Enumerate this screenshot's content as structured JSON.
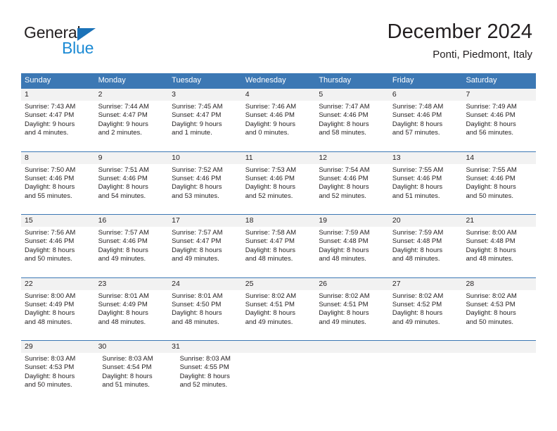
{
  "brand": {
    "name_primary": "General",
    "name_secondary": "Blue",
    "triangle_icon": "brand-triangle-icon",
    "primary_color": "#231f20",
    "secondary_color": "#1b8ad4",
    "triangle_color": "#1b72b8"
  },
  "header": {
    "title": "December 2024",
    "subtitle": "Ponti, Piedmont, Italy"
  },
  "theme": {
    "header_row_bg": "#3c78b4",
    "header_row_text": "#ffffff",
    "daynum_band_bg": "#f2f2f2",
    "grid_line": "#3c78b4",
    "body_text": "#231f20"
  },
  "weekdays": [
    "Sunday",
    "Monday",
    "Tuesday",
    "Wednesday",
    "Thursday",
    "Friday",
    "Saturday"
  ],
  "weeks": [
    {
      "days": [
        {
          "num": "1",
          "sunrise": "Sunrise: 7:43 AM",
          "sunset": "Sunset: 4:47 PM",
          "daylight1": "Daylight: 9 hours",
          "daylight2": "and 4 minutes."
        },
        {
          "num": "2",
          "sunrise": "Sunrise: 7:44 AM",
          "sunset": "Sunset: 4:47 PM",
          "daylight1": "Daylight: 9 hours",
          "daylight2": "and 2 minutes."
        },
        {
          "num": "3",
          "sunrise": "Sunrise: 7:45 AM",
          "sunset": "Sunset: 4:47 PM",
          "daylight1": "Daylight: 9 hours",
          "daylight2": "and 1 minute."
        },
        {
          "num": "4",
          "sunrise": "Sunrise: 7:46 AM",
          "sunset": "Sunset: 4:46 PM",
          "daylight1": "Daylight: 9 hours",
          "daylight2": "and 0 minutes."
        },
        {
          "num": "5",
          "sunrise": "Sunrise: 7:47 AM",
          "sunset": "Sunset: 4:46 PM",
          "daylight1": "Daylight: 8 hours",
          "daylight2": "and 58 minutes."
        },
        {
          "num": "6",
          "sunrise": "Sunrise: 7:48 AM",
          "sunset": "Sunset: 4:46 PM",
          "daylight1": "Daylight: 8 hours",
          "daylight2": "and 57 minutes."
        },
        {
          "num": "7",
          "sunrise": "Sunrise: 7:49 AM",
          "sunset": "Sunset: 4:46 PM",
          "daylight1": "Daylight: 8 hours",
          "daylight2": "and 56 minutes."
        }
      ]
    },
    {
      "days": [
        {
          "num": "8",
          "sunrise": "Sunrise: 7:50 AM",
          "sunset": "Sunset: 4:46 PM",
          "daylight1": "Daylight: 8 hours",
          "daylight2": "and 55 minutes."
        },
        {
          "num": "9",
          "sunrise": "Sunrise: 7:51 AM",
          "sunset": "Sunset: 4:46 PM",
          "daylight1": "Daylight: 8 hours",
          "daylight2": "and 54 minutes."
        },
        {
          "num": "10",
          "sunrise": "Sunrise: 7:52 AM",
          "sunset": "Sunset: 4:46 PM",
          "daylight1": "Daylight: 8 hours",
          "daylight2": "and 53 minutes."
        },
        {
          "num": "11",
          "sunrise": "Sunrise: 7:53 AM",
          "sunset": "Sunset: 4:46 PM",
          "daylight1": "Daylight: 8 hours",
          "daylight2": "and 52 minutes."
        },
        {
          "num": "12",
          "sunrise": "Sunrise: 7:54 AM",
          "sunset": "Sunset: 4:46 PM",
          "daylight1": "Daylight: 8 hours",
          "daylight2": "and 52 minutes."
        },
        {
          "num": "13",
          "sunrise": "Sunrise: 7:55 AM",
          "sunset": "Sunset: 4:46 PM",
          "daylight1": "Daylight: 8 hours",
          "daylight2": "and 51 minutes."
        },
        {
          "num": "14",
          "sunrise": "Sunrise: 7:55 AM",
          "sunset": "Sunset: 4:46 PM",
          "daylight1": "Daylight: 8 hours",
          "daylight2": "and 50 minutes."
        }
      ]
    },
    {
      "days": [
        {
          "num": "15",
          "sunrise": "Sunrise: 7:56 AM",
          "sunset": "Sunset: 4:46 PM",
          "daylight1": "Daylight: 8 hours",
          "daylight2": "and 50 minutes."
        },
        {
          "num": "16",
          "sunrise": "Sunrise: 7:57 AM",
          "sunset": "Sunset: 4:46 PM",
          "daylight1": "Daylight: 8 hours",
          "daylight2": "and 49 minutes."
        },
        {
          "num": "17",
          "sunrise": "Sunrise: 7:57 AM",
          "sunset": "Sunset: 4:47 PM",
          "daylight1": "Daylight: 8 hours",
          "daylight2": "and 49 minutes."
        },
        {
          "num": "18",
          "sunrise": "Sunrise: 7:58 AM",
          "sunset": "Sunset: 4:47 PM",
          "daylight1": "Daylight: 8 hours",
          "daylight2": "and 48 minutes."
        },
        {
          "num": "19",
          "sunrise": "Sunrise: 7:59 AM",
          "sunset": "Sunset: 4:48 PM",
          "daylight1": "Daylight: 8 hours",
          "daylight2": "and 48 minutes."
        },
        {
          "num": "20",
          "sunrise": "Sunrise: 7:59 AM",
          "sunset": "Sunset: 4:48 PM",
          "daylight1": "Daylight: 8 hours",
          "daylight2": "and 48 minutes."
        },
        {
          "num": "21",
          "sunrise": "Sunrise: 8:00 AM",
          "sunset": "Sunset: 4:48 PM",
          "daylight1": "Daylight: 8 hours",
          "daylight2": "and 48 minutes."
        }
      ]
    },
    {
      "days": [
        {
          "num": "22",
          "sunrise": "Sunrise: 8:00 AM",
          "sunset": "Sunset: 4:49 PM",
          "daylight1": "Daylight: 8 hours",
          "daylight2": "and 48 minutes."
        },
        {
          "num": "23",
          "sunrise": "Sunrise: 8:01 AM",
          "sunset": "Sunset: 4:49 PM",
          "daylight1": "Daylight: 8 hours",
          "daylight2": "and 48 minutes."
        },
        {
          "num": "24",
          "sunrise": "Sunrise: 8:01 AM",
          "sunset": "Sunset: 4:50 PM",
          "daylight1": "Daylight: 8 hours",
          "daylight2": "and 48 minutes."
        },
        {
          "num": "25",
          "sunrise": "Sunrise: 8:02 AM",
          "sunset": "Sunset: 4:51 PM",
          "daylight1": "Daylight: 8 hours",
          "daylight2": "and 49 minutes."
        },
        {
          "num": "26",
          "sunrise": "Sunrise: 8:02 AM",
          "sunset": "Sunset: 4:51 PM",
          "daylight1": "Daylight: 8 hours",
          "daylight2": "and 49 minutes."
        },
        {
          "num": "27",
          "sunrise": "Sunrise: 8:02 AM",
          "sunset": "Sunset: 4:52 PM",
          "daylight1": "Daylight: 8 hours",
          "daylight2": "and 49 minutes."
        },
        {
          "num": "28",
          "sunrise": "Sunrise: 8:02 AM",
          "sunset": "Sunset: 4:53 PM",
          "daylight1": "Daylight: 8 hours",
          "daylight2": "and 50 minutes."
        }
      ]
    },
    {
      "days": [
        {
          "num": "29",
          "sunrise": "Sunrise: 8:03 AM",
          "sunset": "Sunset: 4:53 PM",
          "daylight1": "Daylight: 8 hours",
          "daylight2": "and 50 minutes."
        },
        {
          "num": "30",
          "sunrise": "Sunrise: 8:03 AM",
          "sunset": "Sunset: 4:54 PM",
          "daylight1": "Daylight: 8 hours",
          "daylight2": "and 51 minutes."
        },
        {
          "num": "31",
          "sunrise": "Sunrise: 8:03 AM",
          "sunset": "Sunset: 4:55 PM",
          "daylight1": "Daylight: 8 hours",
          "daylight2": "and 52 minutes."
        }
      ]
    }
  ]
}
